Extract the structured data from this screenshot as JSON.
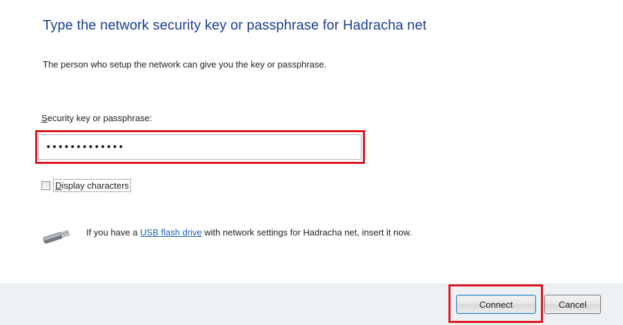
{
  "dialog": {
    "heading": "Type the network security key or passphrase for Hadracha net",
    "subtext": "The person who setup the network can give you the key or passphrase.",
    "key_label_access": "S",
    "key_label_rest": "ecurity key or passphrase:",
    "key_value": "•••••••••••••",
    "display_access": "D",
    "display_rest": "isplay characters",
    "display_checked": false,
    "usb_prefix": "If you have a ",
    "usb_link": "USB flash drive",
    "usb_suffix": " with network settings for Hadracha net, insert it now.",
    "usb_icon": "usb-drive-icon"
  },
  "buttons": {
    "connect": "Connect",
    "cancel": "Cancel"
  },
  "colors": {
    "heading": "#1a3f8f",
    "highlight": "#e0141c",
    "link": "#1c5bb8",
    "footer": "#eef1f4"
  }
}
